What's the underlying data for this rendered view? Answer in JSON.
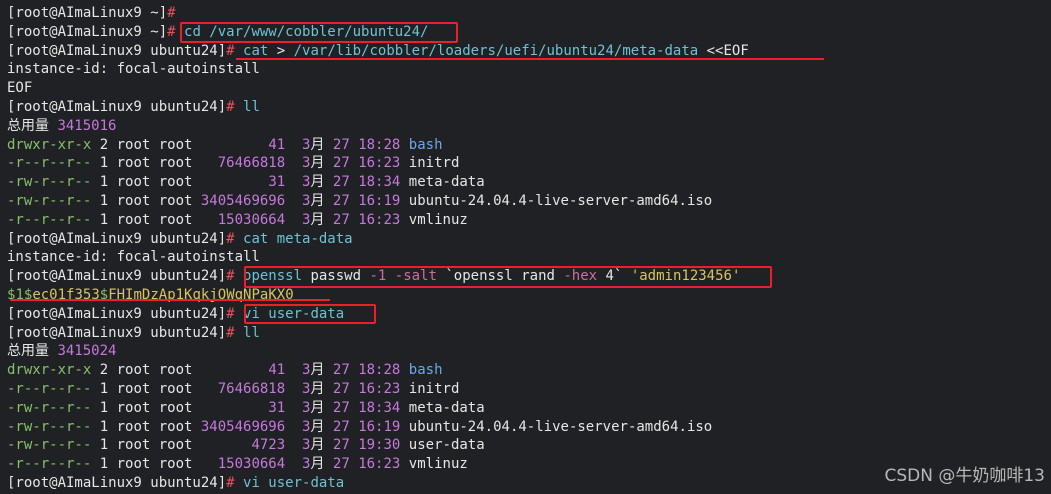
{
  "prompt_root": "[root@AImaLinux9 ~]",
  "prompt_ubuntu": "[root@AImaLinux9 ubuntu24]",
  "hash": "#",
  "commands": {
    "cd": " cd /var/www/cobbler/ubuntu24/",
    "cat_heredoc": " cat > /var/lib/cobbler/loaders/uefi/ubuntu24/meta-data <<EOF",
    "ll": " ll",
    "cat_meta": " cat meta-data",
    "openssl_1": " openssl passwd -1 -salt `openssl rand -hex 4` 'admin123456'",
    "vi_user_data": " vi user-data"
  },
  "output": {
    "instance_id": "instance-id: focal-autoinstall",
    "eof": "EOF",
    "hash_result": "$1$ec01f353$FHImDzAp1KqkjOWqNPaKX0"
  },
  "listing1": {
    "total": "总用量 3415016",
    "rows": [
      {
        "perm": "drwxr-xr-x",
        "rest": " 2 root root         41  3月 27 18:28 ",
        "name": "bash",
        "dir": true
      },
      {
        "perm": "-r--r--r--",
        "rest": " 1 root root   76466818  3月 27 16:23 ",
        "name": "initrd",
        "dir": false
      },
      {
        "perm": "-rw-r--r--",
        "rest": " 1 root root         31  3月 27 18:34 ",
        "name": "meta-data",
        "dir": false
      },
      {
        "perm": "-rw-r--r--",
        "rest": " 1 root root 3405469696  3月 27 16:19 ",
        "name": "ubuntu-24.04.4-live-server-amd64.iso",
        "dir": false
      },
      {
        "perm": "-r--r--r--",
        "rest": " 1 root root   15030664  3月 27 16:23 ",
        "name": "vmlinuz",
        "dir": false
      }
    ]
  },
  "listing2": {
    "total": "总用量 3415024",
    "rows": [
      {
        "perm": "drwxr-xr-x",
        "rest": " 2 root root         41  3月 27 18:28 ",
        "name": "bash",
        "dir": true
      },
      {
        "perm": "-r--r--r--",
        "rest": " 1 root root   76466818  3月 27 16:23 ",
        "name": "initrd",
        "dir": false
      },
      {
        "perm": "-rw-r--r--",
        "rest": " 1 root root         31  3月 27 18:34 ",
        "name": "meta-data",
        "dir": false
      },
      {
        "perm": "-rw-r--r--",
        "rest": " 1 root root 3405469696  3月 27 16:19 ",
        "name": "ubuntu-24.04.4-live-server-amd64.iso",
        "dir": false
      },
      {
        "perm": "-rw-r--r--",
        "rest": " 1 root root       4723  3月 27 19:30 ",
        "name": "user-data",
        "dir": false
      },
      {
        "perm": "-r--r--r--",
        "rest": " 1 root root   15030664  3月 27 16:23 ",
        "name": "vmlinuz",
        "dir": false
      }
    ]
  },
  "watermark": "CSDN @牛奶咖啡13",
  "colors": {
    "background": "#1f2124",
    "prompt_hash": "#e7515c",
    "highlight_box": "#e8212b"
  }
}
